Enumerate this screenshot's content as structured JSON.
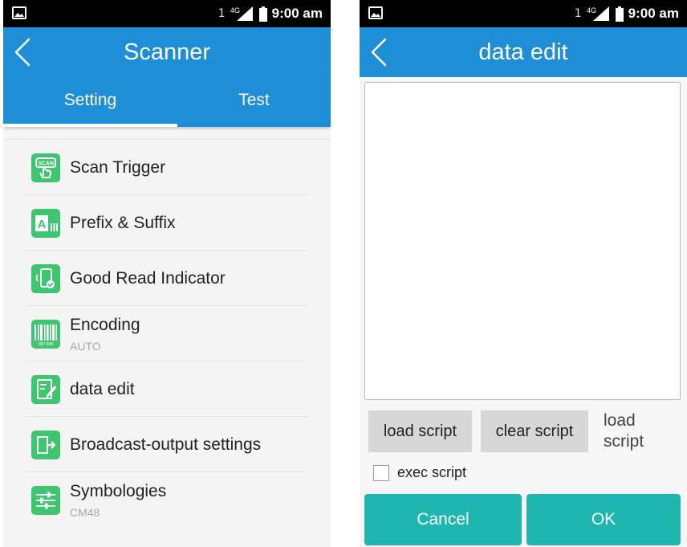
{
  "status": {
    "sim": "1",
    "network": "4G",
    "time": "9:00 am"
  },
  "left": {
    "title": "Scanner",
    "tabs": [
      "Setting",
      "Test"
    ],
    "items": [
      {
        "label": "Scan Trigger",
        "icon": "scan-trigger-icon"
      },
      {
        "label": "Prefix & Suffix",
        "icon": "prefix-suffix-icon"
      },
      {
        "label": "Good Read Indicator",
        "icon": "good-read-indicator-icon"
      },
      {
        "label": "Encoding",
        "sub": "AUTO",
        "icon": "barcode-icon"
      },
      {
        "label": "data edit",
        "icon": "data-edit-icon"
      },
      {
        "label": "Broadcast-output settings",
        "icon": "broadcast-output-icon"
      },
      {
        "label": "Symbologies",
        "sub": "CM48",
        "icon": "symbologies-icon"
      }
    ],
    "icon_texts": {
      "scan_trigger": "SCAN",
      "encoding_digits": "967 658",
      "prefix_letter": "A"
    }
  },
  "right": {
    "title": "data edit",
    "script_text": "",
    "load_script_button": "load script",
    "clear_script_button": "clear script",
    "status_label": "load script",
    "exec_script_label": "exec script",
    "exec_script_checked": false,
    "cancel_button": "Cancel",
    "ok_button": "OK"
  },
  "colors": {
    "primary": "#1e8fd6",
    "accent_green": "#3dc56f",
    "teal": "#20b6b0",
    "status_bar": "#000000"
  }
}
